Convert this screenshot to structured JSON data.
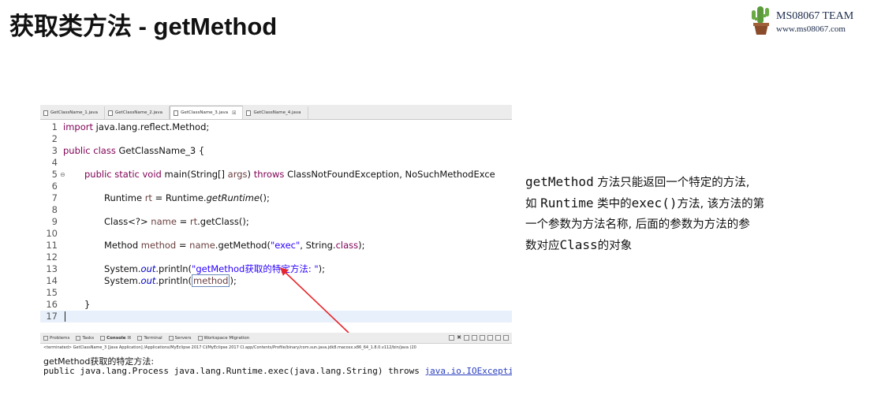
{
  "slide": {
    "title": "获取类方法 - getMethod",
    "logo_line1": "MS08067 TEAM",
    "logo_line2": "www.ms08067.com",
    "logo_icon": "cactus-logo-icon"
  },
  "ide": {
    "tabs": [
      {
        "label": "GetClassName_1.java",
        "active": false
      },
      {
        "label": "GetClassName_2.java",
        "active": false
      },
      {
        "label": "GetClassName_3.java",
        "active": true,
        "close": "☒"
      },
      {
        "label": "GetClassName_4.java",
        "active": false
      }
    ],
    "line_numbers": [
      "1",
      "2",
      "3",
      "4",
      "5",
      "6",
      "7",
      "8",
      "9",
      "10",
      "11",
      "12",
      "13",
      "14",
      "15",
      "16",
      "17"
    ],
    "code": {
      "l1_kw": "import",
      "l1_rest": " java.lang.reflect.Method;",
      "l3_kw1": "public",
      "l3_kw2": "class",
      "l3_rest": " GetClassName_3 {",
      "l5_fold": "⊖",
      "l5_kw1": "public",
      "l5_kw2": "static",
      "l5_kw3": "void",
      "l5_mid": " main(String[] ",
      "l5_args": "args",
      "l5_mid2": ") ",
      "l5_kw4": "throws",
      "l5_rest": " ClassNotFoundException, NoSuchMethodExce",
      "l7_a": "Runtime ",
      "l7_var": "rt",
      "l7_b": " = Runtime.",
      "l7_m": "getRuntime",
      "l7_c": "();",
      "l9_a": "Class<?> ",
      "l9_var": "name",
      "l9_b": " = ",
      "l9_var2": "rt",
      "l9_c": ".getClass();",
      "l11_a": "Method ",
      "l11_var": "method",
      "l11_b": " = ",
      "l11_var2": "name",
      "l11_c": ".getMethod(",
      "l11_str": "\"exec\"",
      "l11_d": ", String.",
      "l11_kw": "class",
      "l11_e": ");",
      "l13_a": "System.",
      "l13_fld": "out",
      "l13_b": ".println(",
      "l13_str": "\"getMethod获取的特定方法: \"",
      "l13_c": ");",
      "l14_a": "System.",
      "l14_fld": "out",
      "l14_b": ".println(",
      "l14_var": "method",
      "l14_c": ");",
      "l16": "}"
    },
    "console": {
      "tabs": [
        {
          "label": "Problems",
          "active": false
        },
        {
          "label": "Tasks",
          "active": false
        },
        {
          "label": "Console ☒",
          "active": true
        },
        {
          "label": "Terminal",
          "active": false
        },
        {
          "label": "Servers",
          "active": false
        },
        {
          "label": "Workspace Migration",
          "active": false
        }
      ],
      "terminated": "<terminated> GetClassName_3 [Java Application] /Applications/MyEclipse 2017 CI/MyEclipse 2017 CI.app/Contents/Profile/binary/com.sun.java.jdk8.macosx.x86_64_1.8.0.v112/bin/java (20",
      "output_line1": "getMethod获取的特定方法:",
      "output_line2_text": "public java.lang.Process java.lang.Runtime.exec(java.lang.String) throws ",
      "output_line2_link": "java.io.IOException"
    }
  },
  "explanation": {
    "p1_code": "getMethod",
    "p1_text": " 方法只能返回一个特定的方法,",
    "p2_pre": "如 ",
    "p2_code1": "Runtime",
    "p2_mid": " 类中的",
    "p2_code2": "exec()",
    "p2_text": "方法, 该方法的第",
    "p3": "一个参数为方法名称, 后面的参数为方法的参",
    "p4_pre": "数对应",
    "p4_code": "Class",
    "p4_post": "的对象"
  },
  "colors": {
    "keyword": "#7f0055",
    "string": "#2a00ff",
    "field": "#0000c0",
    "arrow": "#e8262b",
    "current_line": "#e8f0fb"
  }
}
